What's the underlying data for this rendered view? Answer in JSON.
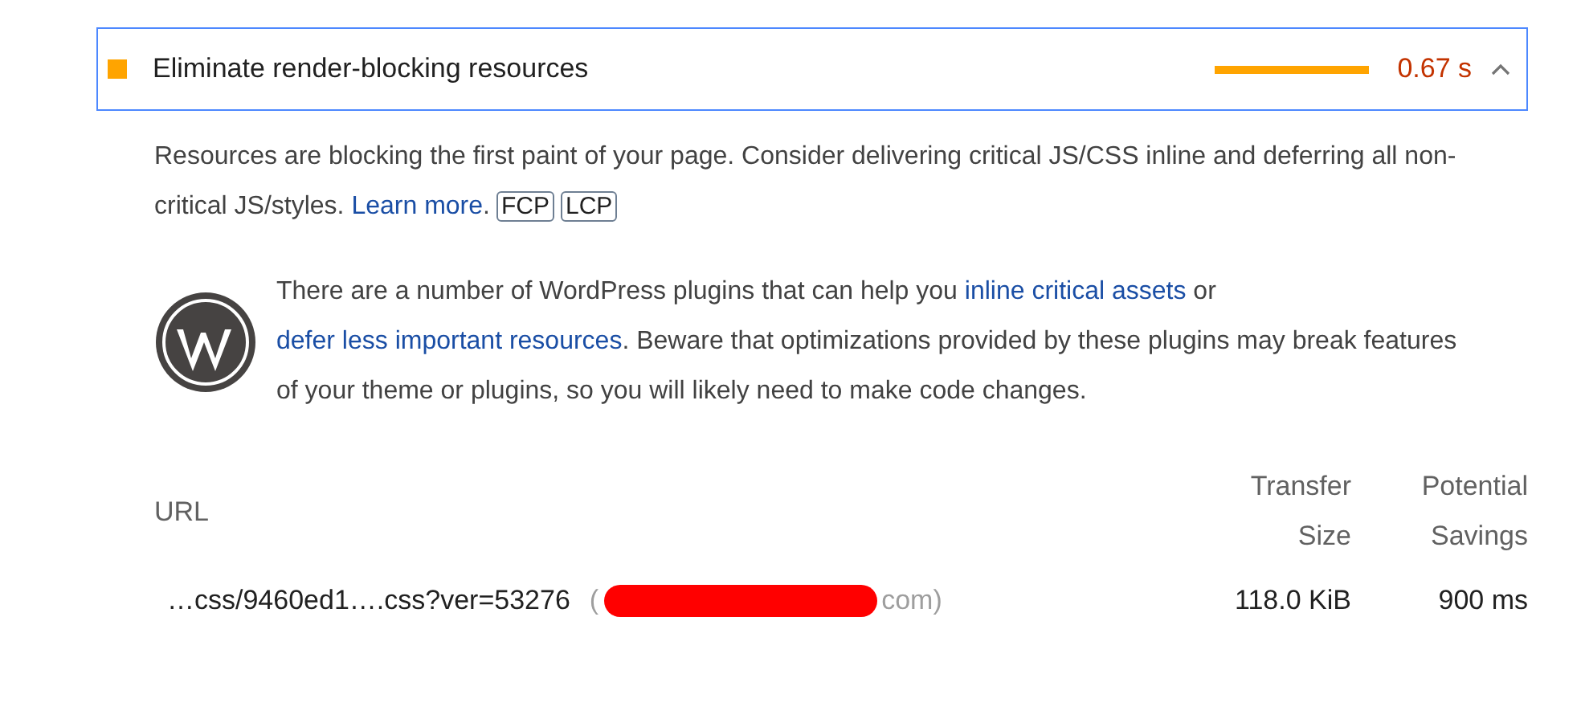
{
  "audit": {
    "title": "Eliminate render-blocking resources",
    "color": "#ffa400",
    "value": "0.67 s",
    "expanded": true
  },
  "description": {
    "text": "Resources are blocking the first paint of your page. Consider delivering critical JS/CSS inline and deferring all non-critical JS/styles.",
    "link": "Learn more",
    "after_link": ".",
    "tags": [
      "FCP",
      "LCP"
    ]
  },
  "stack_pack": {
    "parts": [
      {
        "kind": "text",
        "text": "There are a number of WordPress plugins that can help you "
      },
      {
        "kind": "link",
        "text": "inline critical assets"
      },
      {
        "kind": "text",
        "text": " or "
      },
      {
        "kind": "link",
        "text": "defer less important resources"
      },
      {
        "kind": "text",
        "text": ". Beware that optimizations provided by these plugins may break features of your theme or plugins, so you will likely need to make code changes."
      }
    ]
  },
  "table": {
    "columns": [
      "URL",
      "Transfer Size",
      "Potential Savings"
    ],
    "rows": [
      {
        "url": "…css/9460ed1….css?ver=53276",
        "host_open": "(",
        "host_end": "com)",
        "size": "118.0 KiB",
        "savings": "900 ms"
      }
    ]
  }
}
